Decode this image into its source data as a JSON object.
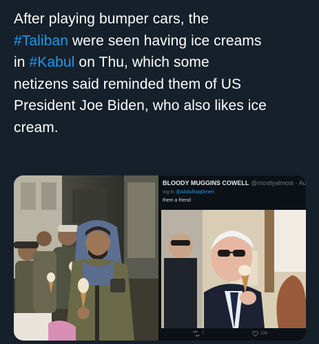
{
  "tweet": {
    "line1": "After playing bumper cars, the",
    "hashtag1": "#Taliban",
    "line2_after": " were seen having ice creams",
    "line3_before": "in ",
    "hashtag2": "#Kabul",
    "line3_after": " on Thu, which some",
    "line4": "netizens said reminded them of US",
    "line5": "President Joe Biden, who also likes ice",
    "line6": "cream.",
    "hashtag_color": "#1d9bf0",
    "text_color": "#ffffff",
    "background_color": "#15202b"
  },
  "embedded_tweet": {
    "display_name": "BLOODY MUGGINS COWELL",
    "handle": "@mostlyalmost · Aug",
    "reply_prefix": "ing to ",
    "reply_handle": "@AbdulhaqOmeri",
    "body": "them a friend",
    "retweet_count": "7",
    "like_count": "106"
  },
  "icons": {
    "retweet": "retweet-icon",
    "like": "heart-icon"
  }
}
